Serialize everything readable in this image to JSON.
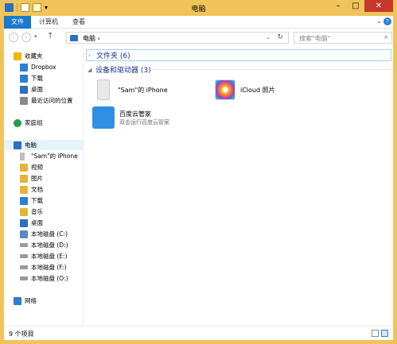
{
  "window": {
    "title": "电脑"
  },
  "ribbon": {
    "tabs": [
      {
        "label": "文件"
      },
      {
        "label": "计算机"
      },
      {
        "label": "查看"
      }
    ]
  },
  "address": {
    "path": "电脑 ›",
    "search_placeholder": "搜索\"电脑\""
  },
  "nav": {
    "items": [
      {
        "label": "收藏夹",
        "icon": "star-icon",
        "color": "#f2b600"
      },
      {
        "label": "Dropbox",
        "icon": "dropbox-icon",
        "color": "#2a7ed3"
      },
      {
        "label": "下载",
        "icon": "download-folder-icon",
        "color": "#2a7ed3"
      },
      {
        "label": "桌面",
        "icon": "desktop-icon",
        "color": "#2f6fc0"
      },
      {
        "label": "最近访问的位置",
        "icon": "recent-places-icon",
        "color": "#8a8a8a"
      },
      {
        "label": "家庭组",
        "icon": "homegroup-icon",
        "color": "#2a9a4b"
      },
      {
        "label": "电脑",
        "icon": "computer-icon",
        "color": "#2b6fc2"
      },
      {
        "label": "\"Sam\"的 iPhone",
        "icon": "iphone-icon",
        "color": "#bfbfbf"
      },
      {
        "label": "视频",
        "icon": "videos-folder-icon",
        "color": "#e4b437"
      },
      {
        "label": "图片",
        "icon": "pictures-folder-icon",
        "color": "#e4b437"
      },
      {
        "label": "文档",
        "icon": "documents-folder-icon",
        "color": "#e4b437"
      },
      {
        "label": "下载",
        "icon": "downloads-folder-icon",
        "color": "#2a7ed3"
      },
      {
        "label": "音乐",
        "icon": "music-folder-icon",
        "color": "#e4b437"
      },
      {
        "label": "桌面",
        "icon": "desktop-folder-icon",
        "color": "#2f6fc0"
      },
      {
        "label": "本地磁盘 (C:)",
        "icon": "system-drive-icon",
        "color": "#5a87c6"
      },
      {
        "label": "本地磁盘 (D:)",
        "icon": "drive-icon",
        "color": "#9a9a9a"
      },
      {
        "label": "本地磁盘 (E:)",
        "icon": "drive-icon",
        "color": "#9a9a9a"
      },
      {
        "label": "本地磁盘 (F:)",
        "icon": "drive-icon",
        "color": "#9a9a9a"
      },
      {
        "label": "本地磁盘 (O:)",
        "icon": "drive-icon",
        "color": "#9a9a9a"
      },
      {
        "label": "网络",
        "icon": "network-icon",
        "color": "#2a7ed3"
      }
    ]
  },
  "content": {
    "folders_group": {
      "label": "文件夹 (6)"
    },
    "devices_group": {
      "label": "设备和驱动器 (3)"
    },
    "devices": [
      {
        "name": "\"Sam\"的 iPhone",
        "sub": "",
        "icon": "iphone-device-icon"
      },
      {
        "name": "iCloud 照片",
        "sub": "",
        "icon": "icloud-photos-icon"
      },
      {
        "name": "百度云管家",
        "sub": "双击运行百度云管家",
        "icon": "baidu-cloud-icon"
      }
    ]
  },
  "status": {
    "count": "9 个项目"
  },
  "colors": {
    "title_bar": "#f0c45a",
    "accent": "#1979ca",
    "close": "#c7372c"
  }
}
